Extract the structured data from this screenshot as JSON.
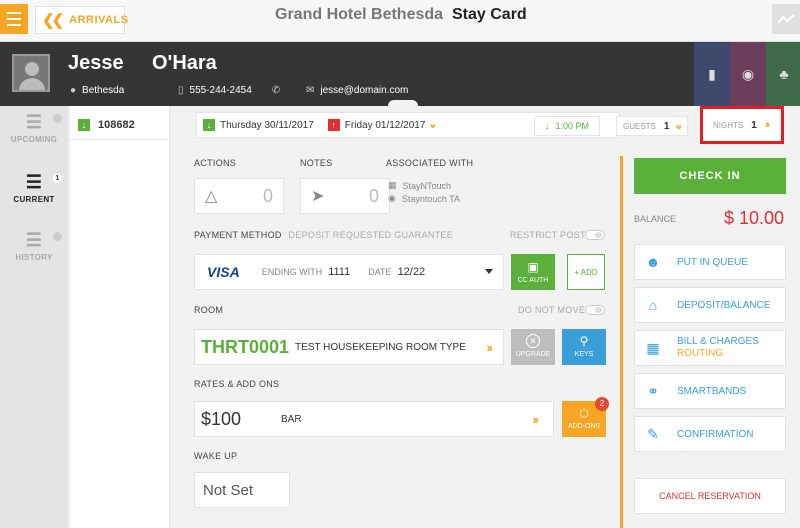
{
  "topbar": {
    "back_label": "ARRIVALS",
    "hotel_name": "Grand Hotel Bethesda",
    "page_title": "Stay Card"
  },
  "guest": {
    "first_name": "Jesse",
    "last_name": "O'Hara",
    "city": "Bethesda",
    "phone": "555-244-2454",
    "email": "jesse@domain.com"
  },
  "nav": {
    "items": [
      {
        "label": "UPCOMING",
        "badge": ""
      },
      {
        "label": "CURRENT",
        "badge": "1"
      },
      {
        "label": "HISTORY",
        "badge": ""
      }
    ]
  },
  "reservation": {
    "number": "108682"
  },
  "dates": {
    "arrival": "Thursday 30/11/2017",
    "departure": "Friday 01/12/2017",
    "time": "1:00 PM",
    "guests_label": "GUESTS",
    "guests_value": "1",
    "nights_label": "NIGHTS",
    "nights_value": "1"
  },
  "sections": {
    "actions_label": "ACTIONS",
    "actions_count": "0",
    "notes_label": "NOTES",
    "notes_count": "0",
    "associated_label": "ASSOCIATED WITH",
    "associated_company": "StayNTouch",
    "associated_ta": "Stayntouch TA"
  },
  "payment": {
    "label": "PAYMENT METHOD",
    "sublabel": "DEPOSIT REQUESTED GUARANTEE",
    "restrict_label": "RESTRICT POST",
    "card_brand": "VISA",
    "ending_label": "ENDING WITH",
    "ending_value": "1111",
    "date_label": "DATE",
    "date_value": "12/22",
    "cc_auth_label": "CC AUTH",
    "add_label": "+ ADD"
  },
  "room": {
    "label": "ROOM",
    "do_not_move_label": "DO NOT MOVE",
    "number": "THRT0001",
    "type": "TEST HOUSEKEEPING ROOM TYPE",
    "upgrade_label": "UPGRADE",
    "keys_label": "KEYS"
  },
  "rates": {
    "label": "RATES & ADD ONS",
    "amount": "$100",
    "name": "BAR",
    "addons_label": "ADD-ONS",
    "addons_count": "2"
  },
  "wakeup": {
    "label": "WAKE UP",
    "value": "Not Set"
  },
  "right": {
    "checkin_label": "CHECK IN",
    "balance_label": "BALANCE",
    "balance_value": "$ 10.00",
    "queue_label": "PUT IN QUEUE",
    "deposit_label": "DEPOSIT/BALANCE",
    "bill_label_1": "BILL & CHARGES",
    "bill_label_2": "ROUTING",
    "smartbands_label": "SMARTBANDS",
    "confirmation_label": "CONFIRMATION",
    "cancel_label": "CANCEL RESERVATION"
  },
  "colors": {
    "accent": "#f6a623",
    "green": "#5ab03a",
    "blue": "#3a9fd8",
    "red": "#e03030",
    "header": "#353535"
  }
}
